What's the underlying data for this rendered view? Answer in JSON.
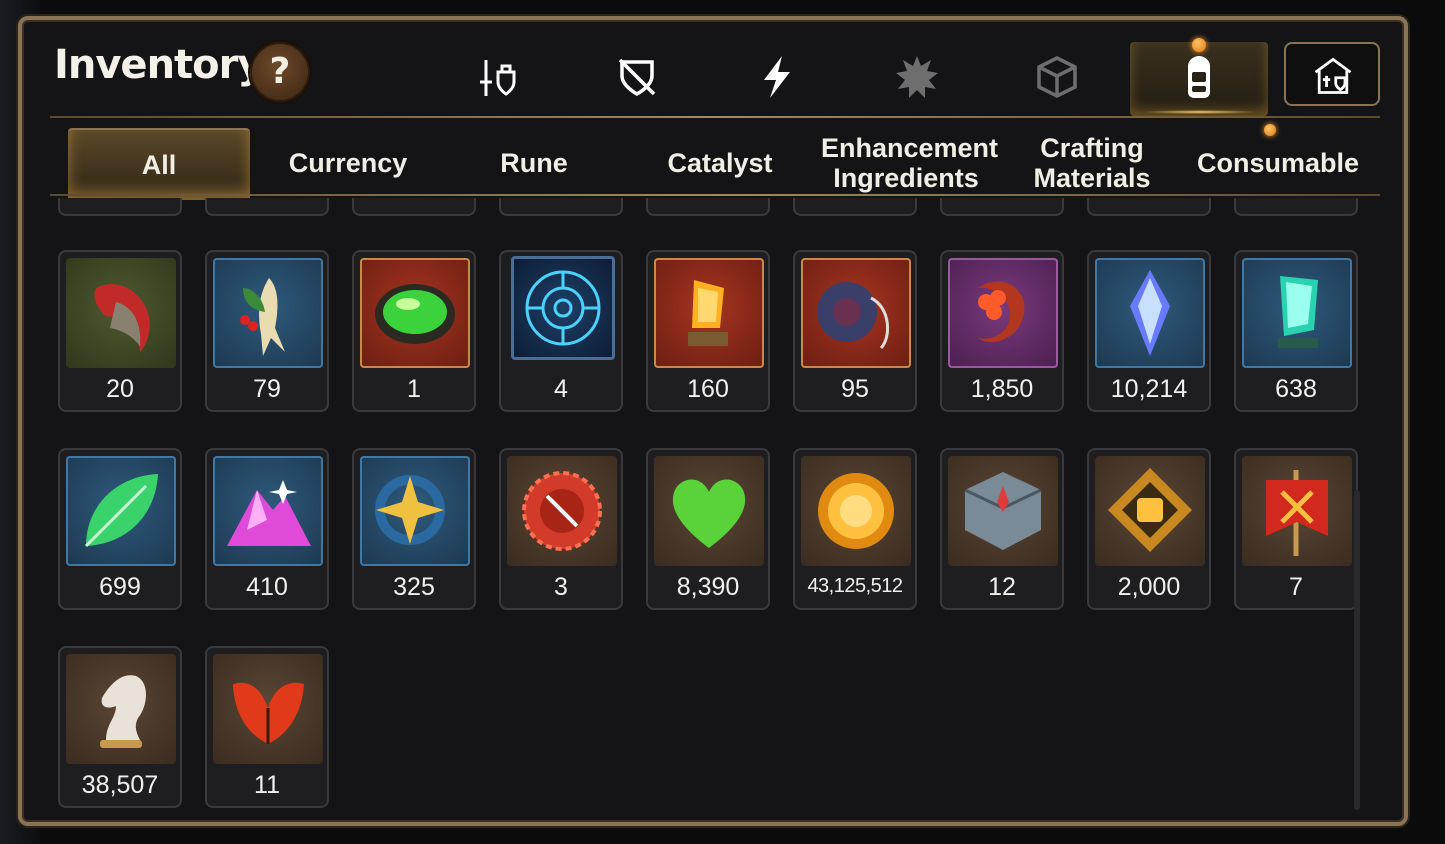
{
  "title": "Inventory",
  "help_label": "?",
  "category_icons": [
    {
      "name": "character-equipment-icon",
      "active": false
    },
    {
      "name": "broken-shield-icon",
      "active": false
    },
    {
      "name": "lightning-icon",
      "active": false
    },
    {
      "name": "burst-icon",
      "active": false
    },
    {
      "name": "dice-icon",
      "active": false
    },
    {
      "name": "backpack-icon",
      "active": true
    },
    {
      "name": "knight-house-icon",
      "active": false
    }
  ],
  "tabs": [
    {
      "label": "All",
      "active": true
    },
    {
      "label": "Currency",
      "active": false
    },
    {
      "label": "Rune",
      "active": false
    },
    {
      "label": "Catalyst",
      "active": false
    },
    {
      "label": "Enhancement Ingredients",
      "active": false
    },
    {
      "label": "Crafting Materials",
      "active": false
    },
    {
      "label": "Consumable",
      "active": false
    }
  ],
  "items": [
    {
      "icon": "red-claw-icon",
      "count": "20"
    },
    {
      "icon": "ginseng-root-icon",
      "count": "79"
    },
    {
      "icon": "green-gem-icon",
      "count": "1"
    },
    {
      "icon": "blue-rune-circle-icon",
      "count": "4"
    },
    {
      "icon": "amber-crystal-icon",
      "count": "160"
    },
    {
      "icon": "pendant-ring-icon",
      "count": "95"
    },
    {
      "icon": "crescent-flower-icon",
      "count": "1,850"
    },
    {
      "icon": "blue-crystal-icon",
      "count": "10,214"
    },
    {
      "icon": "teal-crystal-icon",
      "count": "638"
    },
    {
      "icon": "green-leaf-icon",
      "count": "699"
    },
    {
      "icon": "pink-crystal-pile-icon",
      "count": "410"
    },
    {
      "icon": "star-compass-icon",
      "count": "325"
    },
    {
      "icon": "red-badge-icon",
      "count": "3"
    },
    {
      "icon": "green-heart-icon",
      "count": "8,390"
    },
    {
      "icon": "gold-coin-icon",
      "count": "43,125,512"
    },
    {
      "icon": "stone-cube-icon",
      "count": "12"
    },
    {
      "icon": "fist-emblem-icon",
      "count": "2,000"
    },
    {
      "icon": "red-banner-icon",
      "count": "7"
    },
    {
      "icon": "knight-chess-icon",
      "count": "38,507"
    },
    {
      "icon": "autumn-leaf-icon",
      "count": "11"
    }
  ],
  "colors": {
    "frame": "#8a7453",
    "accent": "#ffb347",
    "panel": "#141416"
  }
}
